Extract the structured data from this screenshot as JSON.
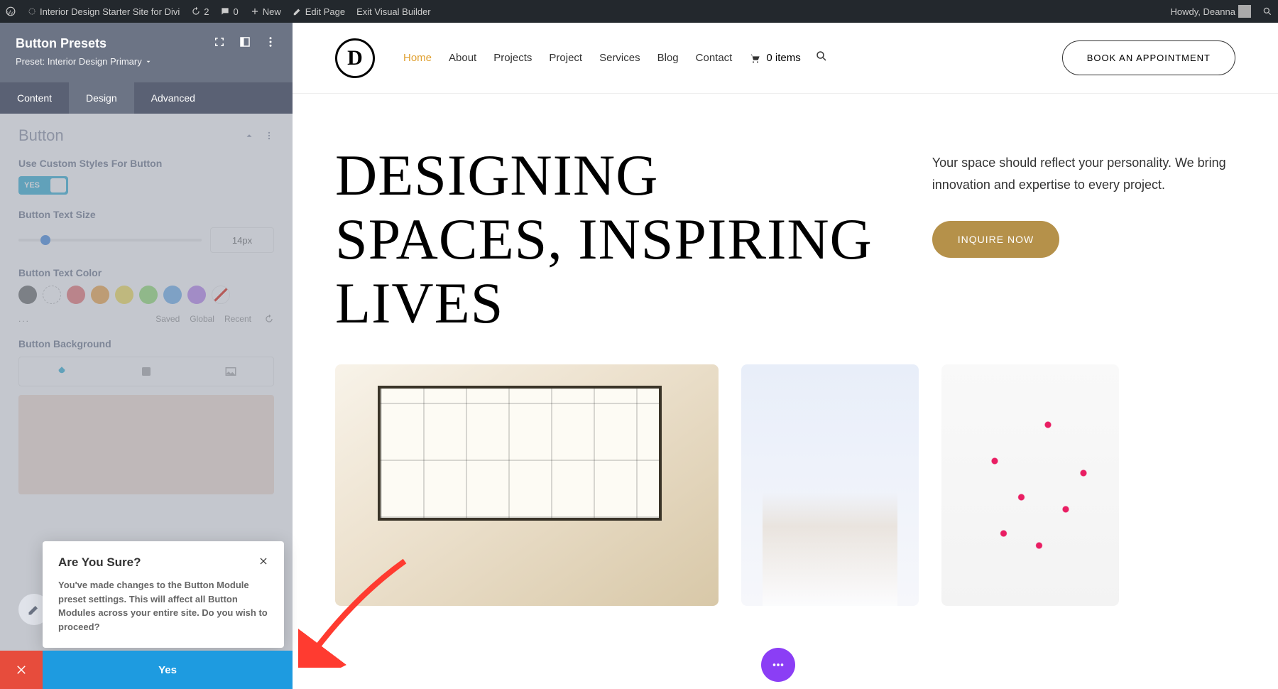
{
  "admin_bar": {
    "site_name": "Interior Design Starter Site for Divi",
    "revisions": "2",
    "comments": "0",
    "new": "New",
    "edit_page": "Edit Page",
    "exit_vb": "Exit Visual Builder",
    "howdy": "Howdy, Deanna"
  },
  "sidebar": {
    "title": "Button Presets",
    "preset_label": "Preset: Interior Design Primary",
    "tabs": [
      "Content",
      "Design",
      "Advanced"
    ],
    "section_title": "Button",
    "fields": {
      "custom_styles_label": "Use Custom Styles For Button",
      "toggle_value": "YES",
      "text_size_label": "Button Text Size",
      "text_size_value": "14px",
      "text_color_label": "Button Text Color",
      "color_tabs": [
        "Saved",
        "Global",
        "Recent"
      ],
      "background_label": "Button Background"
    },
    "swatches": [
      "#888888",
      "#ffffff",
      "#ef8f8f",
      "#f3b76b",
      "#f7e67a",
      "#a8e68e",
      "#8bbff0",
      "#c79cf2",
      "none"
    ]
  },
  "confirm": {
    "title": "Are You Sure?",
    "text": "You've made changes to the Button Module preset settings. This will affect all Button Modules across your entire site. Do you wish to proceed?",
    "yes": "Yes"
  },
  "site": {
    "nav": [
      "Home",
      "About",
      "Projects",
      "Project",
      "Services",
      "Blog",
      "Contact"
    ],
    "cart": "0 items",
    "cta": "BOOK AN APPOINTMENT",
    "hero_title": "DESIGNING SPACES, INSPIRING LIVES",
    "hero_text": "Your space should reflect your personality. We bring innovation and expertise to every project.",
    "inquire": "INQUIRE NOW"
  }
}
